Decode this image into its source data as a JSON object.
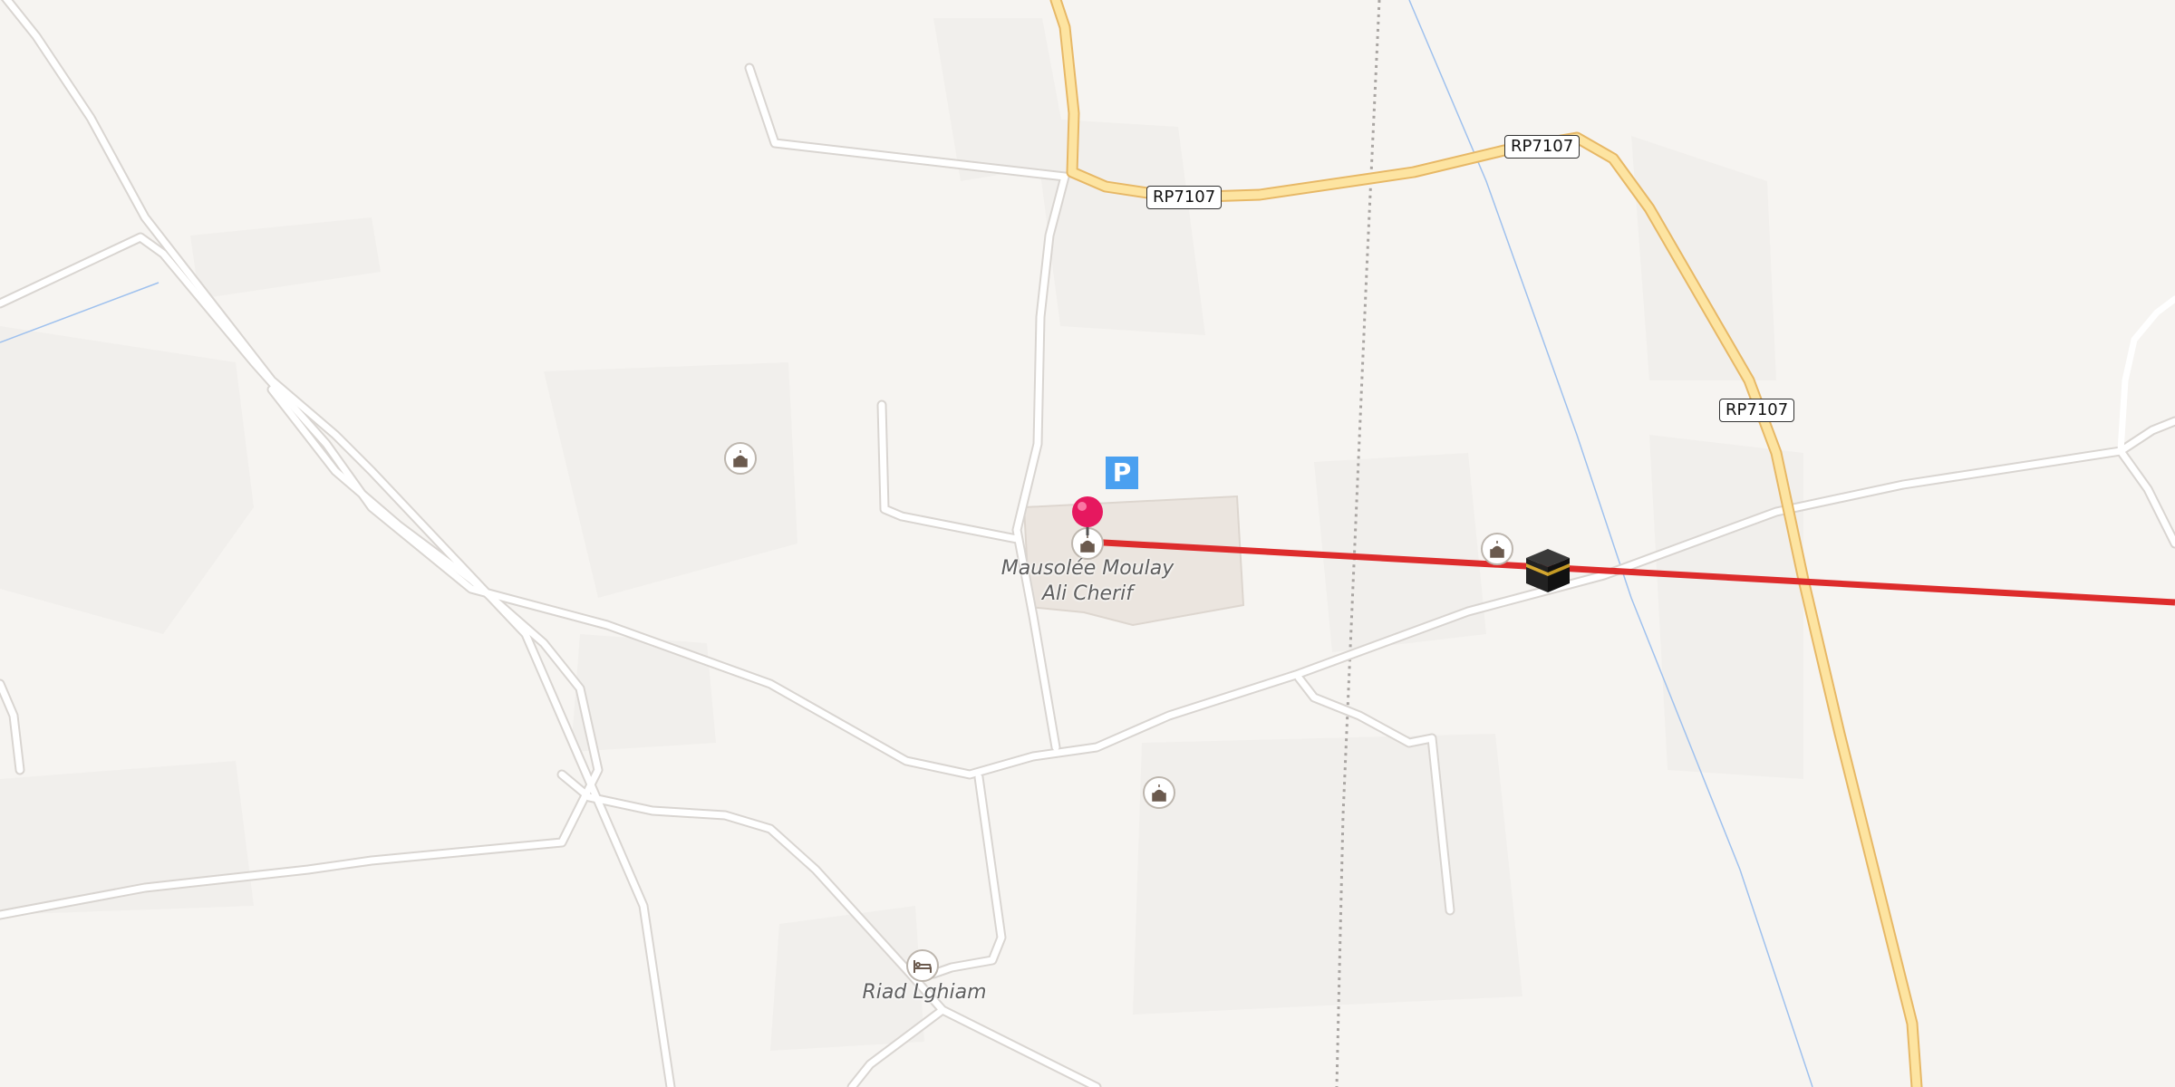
{
  "map": {
    "roads": {
      "route_number": "RP7107",
      "shields": [
        "RP7107",
        "RP7107",
        "RP7107"
      ]
    },
    "places": {
      "mausoleum_name": "Mausolée Moulay\nAli Cherif",
      "riad_name": "Riad Lghiam"
    },
    "icons": {
      "parking": "P",
      "mosque": "mosque-icon",
      "lodging": "bed-icon",
      "pin": "location-pin-icon",
      "qibla": "kaaba-icon"
    },
    "colors": {
      "background": "#f6f4f1",
      "minor_road": "#ffffff",
      "minor_road_casing": "#d9d5d1",
      "primary_road": "#fde4a1",
      "primary_road_casing": "#e7b866",
      "qibla_line": "#dd2c2c",
      "parking": "#4aa0f0",
      "pin": "#e6185f",
      "water_line": "#9fc1ee"
    }
  }
}
